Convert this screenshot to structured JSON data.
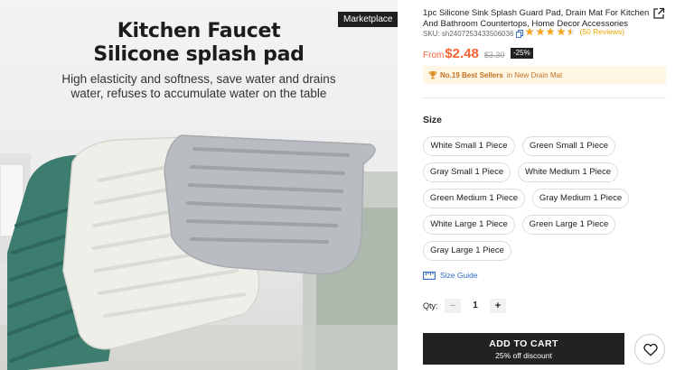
{
  "image": {
    "headline_1": "Kitchen Faucet",
    "headline_2": "Silicone splash pad",
    "tagline_1": "High elasticity and softness, save water and drains",
    "tagline_2": "water, refuses to accumulate water on the table",
    "badge": "Marketplace"
  },
  "product": {
    "title": "1pc Silicone Sink Splash Guard Pad, Drain Mat For Kitchen And Bathroom Countertops, Home Decor Accessories",
    "sku": "SKU: sh2407253433506036",
    "rating": 4.5,
    "reviews": "(50 Reviews)",
    "share_icon": "share-external-icon"
  },
  "price": {
    "from": "From",
    "current": "$2.48",
    "original": "$3.30",
    "discount": "-25%",
    "accent_color": "#fa6338"
  },
  "best_seller": {
    "rank": "No.19 Best Sellers",
    "category": "in New Drain Mat",
    "icon": "trophy-icon"
  },
  "size": {
    "label": "Size",
    "options": [
      "White Small 1 Piece",
      "Green Small 1 Piece",
      "Gray Small 1 Piece",
      "White Medium 1 Piece",
      "Green Medium 1 Piece",
      "Gray Medium 1 Piece",
      "White Large 1 Piece",
      "Green Large 1 Piece",
      "Gray Large 1 Piece"
    ],
    "guide": "Size Guide"
  },
  "quantity": {
    "label": "Qty:",
    "minus": "−",
    "value": "1",
    "plus": "+"
  },
  "cart": {
    "label": "ADD TO CART",
    "sub": "25% off discount"
  }
}
